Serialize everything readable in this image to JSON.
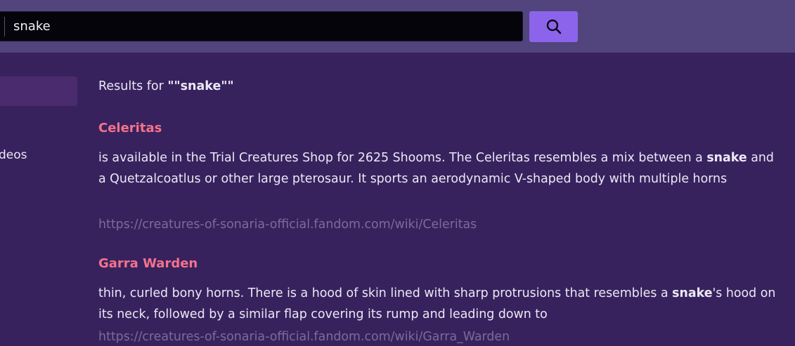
{
  "search": {
    "value": "snake",
    "button_icon": "search-icon"
  },
  "sidebar": {
    "items": [
      {
        "label": ""
      },
      {
        "label": "Videos"
      }
    ]
  },
  "results": {
    "heading_prefix": "Results for ",
    "heading_query": "\"\"snake\"\"",
    "items": [
      {
        "title": "Celeritas",
        "snippet_before": "is available in the Trial Creatures Shop for 2625 Shooms. The Celeritas resembles a mix between a ",
        "snippet_bold": "snake",
        "snippet_after": " and a Quetzalcoatlus or other large pterosaur. It sports an aerodynamic V-shaped body with multiple horns",
        "url": "https://creatures-of-sonaria-official.fandom.com/wiki/Celeritas"
      },
      {
        "title": "Garra Warden",
        "snippet_before": "thin, curled bony horns. There is a hood of skin lined with sharp protrusions that resembles a ",
        "snippet_bold": "snake",
        "snippet_after": "'s hood on its neck, followed by a similar flap covering its rump and leading down to",
        "url": "https://creatures-of-sonaria-official.fandom.com/wiki/Garra_Warden"
      }
    ]
  },
  "colors": {
    "header_bg": "#52447c",
    "page_bg": "#37225e",
    "accent": "#8c64ec",
    "title": "#f5728b",
    "url": "#7c6c98"
  }
}
